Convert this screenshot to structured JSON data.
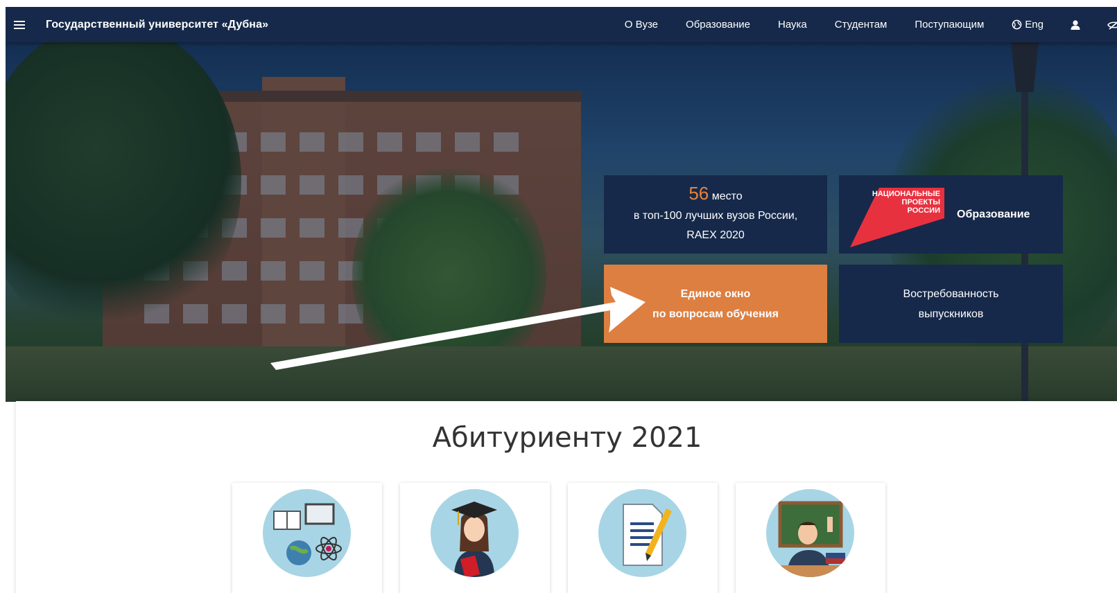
{
  "header": {
    "site_title": "Государственный университет «Дубна»",
    "nav": [
      "О Вузе",
      "Образование",
      "Наука",
      "Студентам",
      "Поступающим"
    ],
    "lang_label": "Eng"
  },
  "tiles": {
    "rank": {
      "number": "56",
      "suffix": " место",
      "line2": "в топ-100 лучших вузов России,",
      "line3": "RAEX 2020"
    },
    "national_projects": {
      "logo_lines": [
        "НАЦИОНАЛЬНЫЕ",
        "ПРОЕКТЫ",
        "РОССИИ"
      ],
      "label": "Образование"
    },
    "single_window": {
      "line1": "Единое окно",
      "line2": "по вопросам обучения"
    },
    "demand": {
      "line1": "Востребованность",
      "line2": "выпускников"
    }
  },
  "section": {
    "title": "Абитуриенту 2021"
  },
  "colors": {
    "navy": "#16294a",
    "orange": "#dd7f40",
    "rank_number": "#e8843a",
    "np_red": "#e8313f"
  },
  "icons": [
    "menu-icon",
    "globe-icon",
    "user-icon",
    "eye-slash-icon"
  ]
}
